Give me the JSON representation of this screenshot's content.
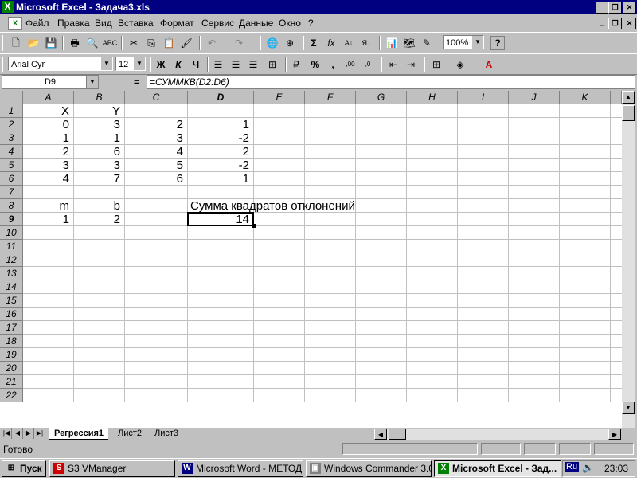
{
  "window": {
    "title": "Microsoft Excel - Задача3.xls"
  },
  "menu": [
    "Файл",
    "Правка",
    "Вид",
    "Вставка",
    "Формат",
    "Сервис",
    "Данные",
    "Окно",
    "?"
  ],
  "toolbar": {
    "zoom": "100%",
    "font_name": "Arial Cyr",
    "font_size": "12",
    "bold": "Ж",
    "italic": "К",
    "underline": "Ч",
    "percent": "%",
    "comma": ",",
    "sum": "Σ",
    "fx": "fx",
    "help": "?"
  },
  "formula_bar": {
    "name_box": "D9",
    "equals": "=",
    "formula": "=СУММКВ(D2:D6)"
  },
  "columns": [
    "A",
    "B",
    "C",
    "D",
    "E",
    "F",
    "G",
    "H",
    "I",
    "J",
    "K"
  ],
  "rows": [
    "1",
    "2",
    "3",
    "4",
    "5",
    "6",
    "7",
    "8",
    "9",
    "10",
    "11",
    "12",
    "13",
    "14",
    "15",
    "16",
    "17",
    "18",
    "19",
    "20",
    "21",
    "22"
  ],
  "cells": {
    "A1": "X",
    "B1": "Y",
    "A2": "0",
    "B2": "3",
    "C2": "2",
    "D2": "1",
    "A3": "1",
    "B3": "1",
    "C3": "3",
    "D3": "-2",
    "A4": "2",
    "B4": "6",
    "C4": "4",
    "D4": "2",
    "A5": "3",
    "B5": "3",
    "C5": "5",
    "D5": "-2",
    "A6": "4",
    "B6": "7",
    "C6": "6",
    "D6": "1",
    "A8": "m",
    "B8": "b",
    "D8": "Сумма квадратов отклонений",
    "A9": "1",
    "B9": "2",
    "D9": "14"
  },
  "active_cell": "D9",
  "sheets": [
    "Регрессия1",
    "Лист2",
    "Лист3"
  ],
  "active_sheet": "Регрессия1",
  "status": "Готово",
  "taskbar": {
    "start": "Пуск",
    "tasks": [
      "S3 VManager",
      "Microsoft Word - МЕТОД...",
      "Windows Commander 3.0...",
      "Microsoft Excel - Зад..."
    ],
    "lang": "Ru",
    "clock": "23:03"
  }
}
